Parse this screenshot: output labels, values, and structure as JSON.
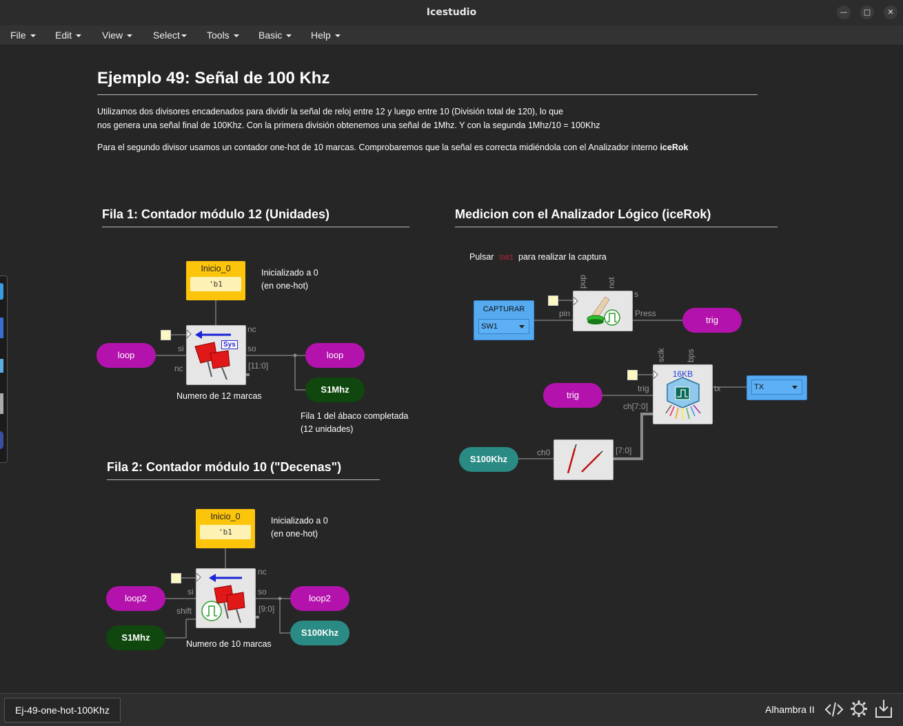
{
  "window": {
    "title": "Icestudio",
    "min_icon": "minimize-icon",
    "max_icon": "maximize-icon",
    "close_icon": "close-icon"
  },
  "menu": [
    "File",
    "Edit",
    "View",
    "Select",
    "Tools",
    "Basic",
    "Help"
  ],
  "doc": {
    "title": "Ejemplo 49: Señal de 100 Khz",
    "p1_line1": "Utilizamos dos divisores encadenados para dividir la señal de reloj entre 12 y luego entre 10 (División total de 120), lo que",
    "p1_line2": "nos genera una señal final de 100Khz. Con la primera división obtenemos una señal de 1Mhz. Y con la segunda 1Mhz/10 = 100Khz",
    "p2_text": "Para el segundo divisor usamos un contador one-hot de 10 marcas. Comprobaremos que la señal es correcta midiéndola con el Analizador interno ",
    "p2_bold": "iceRok"
  },
  "fila1": {
    "heading": "Fila 1: Contador módulo 12 (Unidades)",
    "const_name": "Inicio_0",
    "const_value": "'b1",
    "init_note_1": "Inicializado a 0",
    "init_note_2": "(en one-hot)",
    "in_label": "loop",
    "out_label": "loop",
    "clk_label": "S1Mhz",
    "port_nc_top": "nc",
    "port_si": "si",
    "port_so": "so",
    "port_nc_left": "nc",
    "port_bus": "[11:0]",
    "sys_tag": "Sys",
    "block_caption": "Numero de 12 marcas",
    "done_note_1": "Fila 1 del ábaco completada",
    "done_note_2": "(12 unidades)"
  },
  "fila2": {
    "heading": "Fila 2: Contador módulo 10 (\"Decenas\")",
    "const_name": "Inicio_0",
    "const_value": "'b1",
    "init_note_1": "Inicializado a 0",
    "init_note_2": "(en one-hot)",
    "in_label": "loop2",
    "clk_label": "S1Mhz",
    "out_label": "loop2",
    "out2_label": "S100Khz",
    "port_nc": "nc",
    "port_si": "si",
    "port_so": "so",
    "port_shift": "shift",
    "port_bus": "[9:0]",
    "block_caption": "Numero de 10 marcas"
  },
  "analyzer": {
    "heading": "Medicion con el Analizador Lógico (iceRok)",
    "hint_pre": "Pulsar",
    "hint_sw": "SW1",
    "hint_post": "para realizar la captura",
    "capture_name": "CAPTURAR",
    "capture_value": "SW1",
    "port_pup": "pup",
    "port_not": "not",
    "port_s": "s",
    "port_pin": "pin",
    "port_press": "Press",
    "trig_out": "trig",
    "trig_in": "trig",
    "port_sclk": "sclk",
    "port_bps": "bps",
    "rok_size": "16KB",
    "port_trig": "trig",
    "port_ch": "ch[7:0]",
    "port_tx": "tx",
    "tx_name": "TX",
    "probe_in": "S100Khz",
    "port_ch0": "ch0",
    "port_bus": "[7:0]"
  },
  "status": {
    "file": "Ej-49-one-hot-100Khz",
    "board": "Alhambra II",
    "code_icon": "code-icon",
    "gear_icon": "gear-icon",
    "download_icon": "download-icon"
  }
}
